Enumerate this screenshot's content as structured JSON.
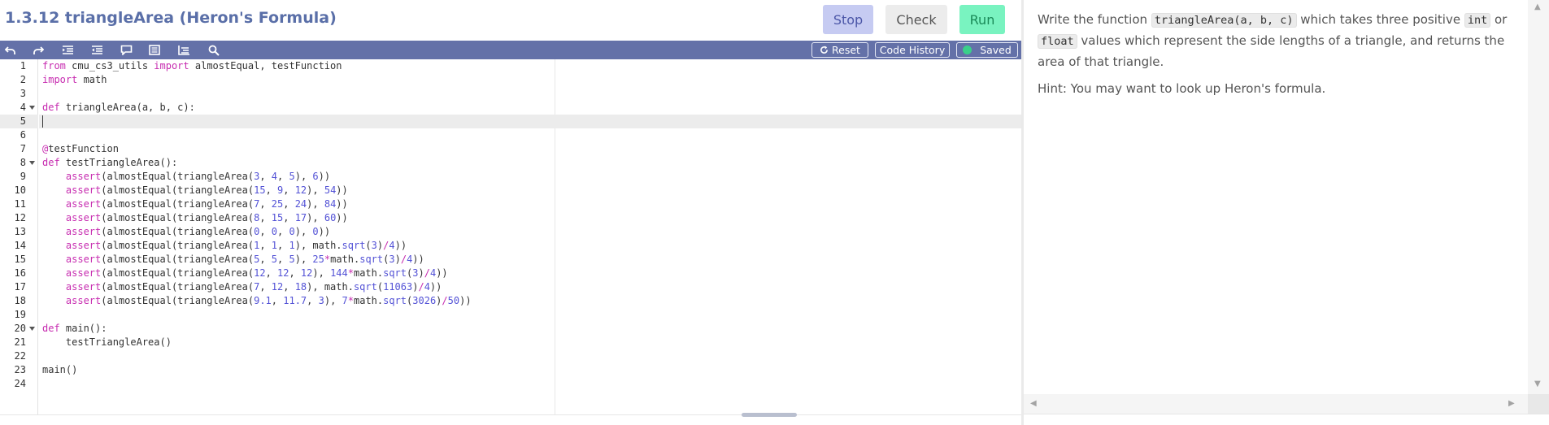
{
  "header": {
    "title": "1.3.12 triangleArea (Heron's Formula)",
    "stop_label": "Stop",
    "check_label": "Check",
    "run_label": "Run"
  },
  "toolbar": {
    "icons": [
      "undo-icon",
      "redo-icon",
      "indent-icon",
      "outdent-icon",
      "comment-icon",
      "format-icon",
      "fold-icon",
      "search-icon"
    ],
    "reset_label": "Reset",
    "history_label": "Code History",
    "saved_label": "Saved"
  },
  "editor": {
    "line_numbers": [
      "1",
      "2",
      "3",
      "4",
      "5",
      "6",
      "7",
      "8",
      "9",
      "10",
      "11",
      "12",
      "13",
      "14",
      "15",
      "16",
      "17",
      "18",
      "19",
      "20",
      "21",
      "22",
      "23",
      "24"
    ],
    "fold_lines": [
      "4",
      "8",
      "20"
    ],
    "active_line": "5",
    "lines": [
      "from cmu_cs3_utils import almostEqual, testFunction",
      "import math",
      "",
      "def triangleArea(a, b, c):",
      "",
      "",
      "@testFunction",
      "def testTriangleArea():",
      "    assert(almostEqual(triangleArea(3, 4, 5), 6))",
      "    assert(almostEqual(triangleArea(15, 9, 12), 54))",
      "    assert(almostEqual(triangleArea(7, 25, 24), 84))",
      "    assert(almostEqual(triangleArea(8, 15, 17), 60))",
      "    assert(almostEqual(triangleArea(0, 0, 0), 0))",
      "    assert(almostEqual(triangleArea(1, 1, 1), math.sqrt(3)/4))",
      "    assert(almostEqual(triangleArea(5, 5, 5), 25*math.sqrt(3)/4))",
      "    assert(almostEqual(triangleArea(12, 12, 12), 144*math.sqrt(3)/4))",
      "    assert(almostEqual(triangleArea(7, 12, 18), math.sqrt(11063)/4))",
      "    assert(almostEqual(triangleArea(9.1, 11.7, 3), 7*math.sqrt(3026)/50))",
      "",
      "def main():",
      "    testTriangleArea()",
      "",
      "main()",
      ""
    ]
  },
  "instructions": {
    "p1_before": "Write the function ",
    "p1_code1": "triangleArea(a, b, c)",
    "p1_mid1": " which takes three positive ",
    "p1_code2": "int",
    "p1_mid2": " or ",
    "p1_code3": "float",
    "p1_after": " values which represent the side lengths of a triangle, and returns the area of that triangle.",
    "hint": "Hint: You may want to look up Heron's formula."
  },
  "colors": {
    "toolbar_bg": "#6471a8",
    "title": "#5a6fa8",
    "stop_bg": "#c6cbf2",
    "check_bg": "#ececec",
    "run_bg": "#79f3c0",
    "keyword": "#c72cb0",
    "number": "#5352d6",
    "saved_dot": "#3ad08a"
  }
}
